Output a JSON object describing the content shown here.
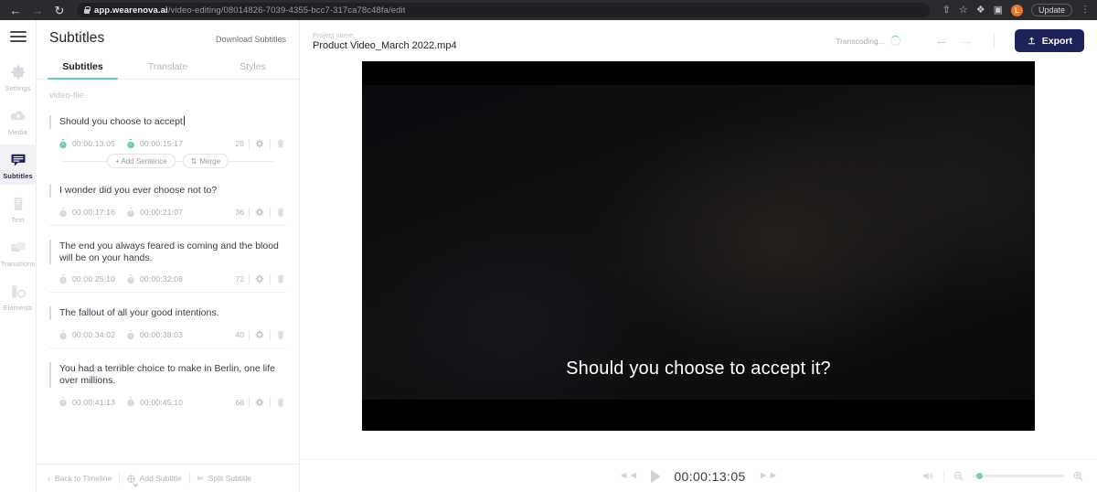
{
  "browser": {
    "back_icon": "back-arrow-icon",
    "forward_icon": "forward-arrow-icon",
    "reload_icon": "reload-icon",
    "url_host": "app.wearenova.ai",
    "url_path": "/video-editing/08014826-7039-4355-bcc7-317ca78c48fa/edit",
    "share_icon": "share-icon",
    "bookmark_icon": "star-icon",
    "extensions_icon": "puzzle-icon",
    "sidepanel_icon": "side-panel-icon",
    "avatar_initial": "L",
    "update_label": "Update",
    "menu_icon": "kebab-menu-icon"
  },
  "rail": {
    "menu_icon": "hamburger-icon",
    "items": [
      {
        "label": "Settings",
        "icon": "gear-icon",
        "active": false
      },
      {
        "label": "Media",
        "icon": "cloud-icon",
        "active": false
      },
      {
        "label": "Subtitles",
        "icon": "subtitles-icon",
        "active": true
      },
      {
        "label": "Text",
        "icon": "text-icon",
        "active": false
      },
      {
        "label": "Transitions",
        "icon": "transitions-icon",
        "active": false
      },
      {
        "label": "Elements",
        "icon": "elements-icon",
        "active": false
      }
    ]
  },
  "panel": {
    "title": "Subtitles",
    "download_label": "Download Subtitles",
    "tabs": [
      {
        "label": "Subtitles",
        "active": true
      },
      {
        "label": "Translate",
        "active": false
      },
      {
        "label": "Styles",
        "active": false
      }
    ],
    "file_name": "video-file",
    "subtitles": [
      {
        "text": "Should you choose to accept",
        "start": "00:00:13:05",
        "end": "00:00:15:17",
        "count": "28",
        "editing": true
      },
      {
        "text": "I wonder did you ever choose not to?",
        "start": "00:00:17:16",
        "end": "00:00:21:07",
        "count": "36",
        "editing": false
      },
      {
        "text": "The end you always feared is coming and the blood will be on your hands.",
        "start": "00:00:25:10",
        "end": "00:00:32:08",
        "count": "72",
        "editing": false
      },
      {
        "text": "The fallout of all your good intentions.",
        "start": "00:00:34:02",
        "end": "00:00:38:03",
        "count": "40",
        "editing": false
      },
      {
        "text": "You had a terrible choice to make in Berlin, one life over millions.",
        "start": "00:00:41:13",
        "end": "00:00:45:10",
        "count": "68",
        "editing": false
      }
    ],
    "add_sentence_label": "+ Add Sentence",
    "merge_label": "Merge",
    "merge_icon": "merge-icon",
    "footer": {
      "back_label": "Back to Timeline",
      "back_icon": "chevron-left-icon",
      "add_label": "Add Subtitle",
      "add_icon": "plus-circle-icon",
      "split_label": "Split Subtitle",
      "split_icon": "scissors-icon",
      "collapse_icon": "chevron-down-icon"
    }
  },
  "topbar": {
    "project_label": "Project name",
    "project_name": "Product Video_March 2022.mp4",
    "status_label": "Transcoding...",
    "spinner_icon": "loading-spinner-icon",
    "undo_icon": "undo-arrow-icon",
    "redo_icon": "redo-arrow-icon",
    "export_label": "Export",
    "export_icon": "upload-icon",
    "export_color": "#1e2259"
  },
  "player": {
    "caption": "Should you choose to accept it?",
    "rewind_icon": "rewind-icon",
    "play_icon": "play-icon",
    "forward_icon": "fast-forward-icon",
    "timecode": "00:00:13:05",
    "volume_icon": "volume-icon",
    "zoom_out_icon": "zoom-out-icon",
    "zoom_in_icon": "zoom-in-icon",
    "accent_color": "#7ec9c1"
  }
}
